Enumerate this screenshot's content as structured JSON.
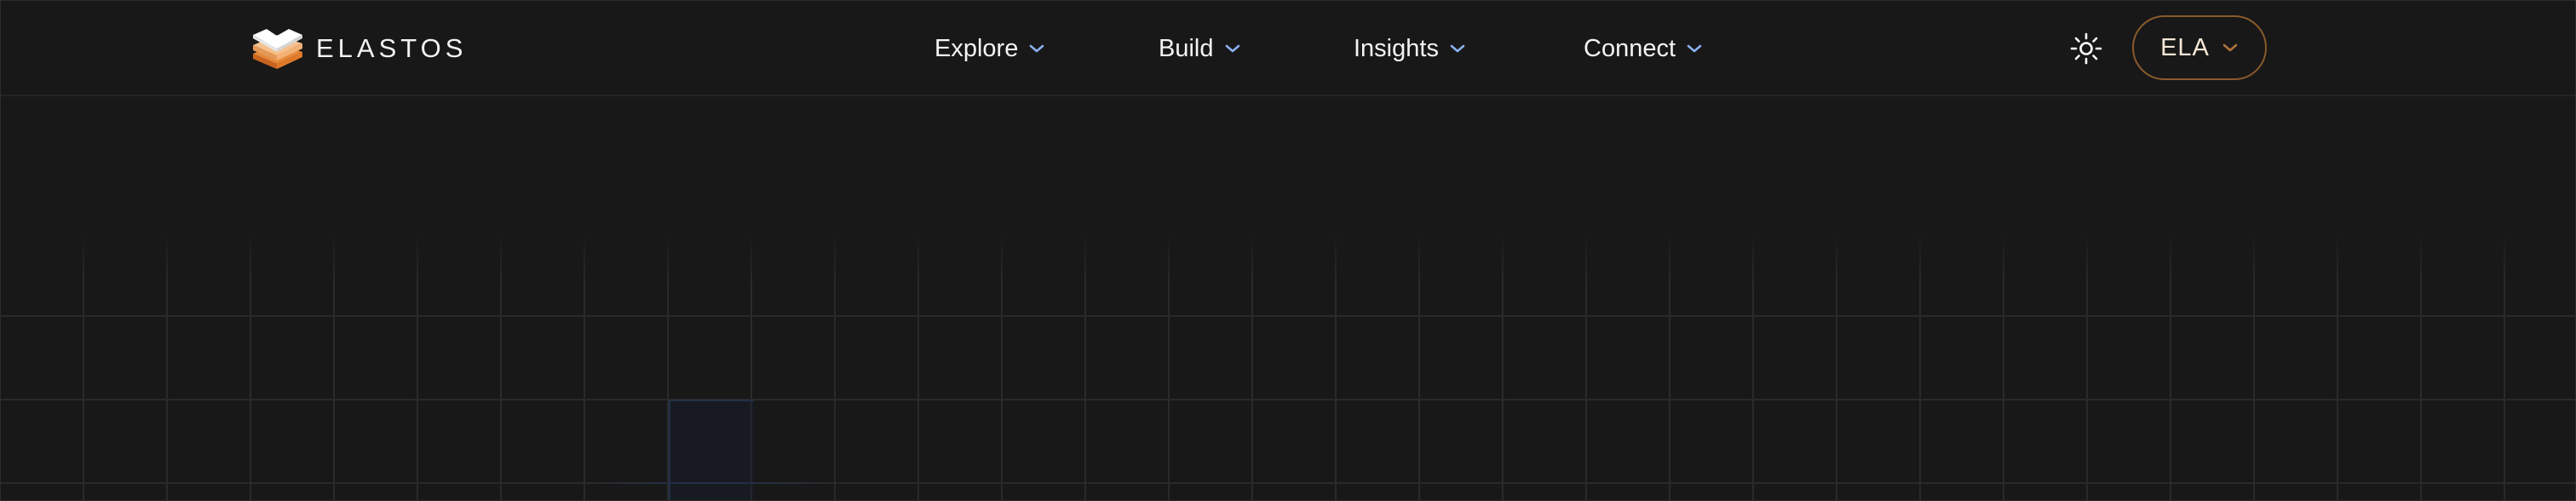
{
  "brand": {
    "name": "ELASTOS",
    "logo_icon": "elastos-stacked-logo-icon"
  },
  "nav": {
    "items": [
      {
        "label": "Explore",
        "icon": "chevron-down-icon"
      },
      {
        "label": "Build",
        "icon": "chevron-down-icon"
      },
      {
        "label": "Insights",
        "icon": "chevron-down-icon"
      },
      {
        "label": "Connect",
        "icon": "chevron-down-icon"
      }
    ]
  },
  "actions": {
    "theme_toggle_icon": "sun-icon",
    "token_label": "ELA",
    "token_icon": "chevron-down-icon"
  },
  "colors": {
    "background": "#181818",
    "nav_chevron": "#8ab0f0",
    "token_accent": "#b07438",
    "logo_top": "#ffffff",
    "logo_mid": "#f3b174",
    "logo_bottom": "#e07a2a"
  }
}
